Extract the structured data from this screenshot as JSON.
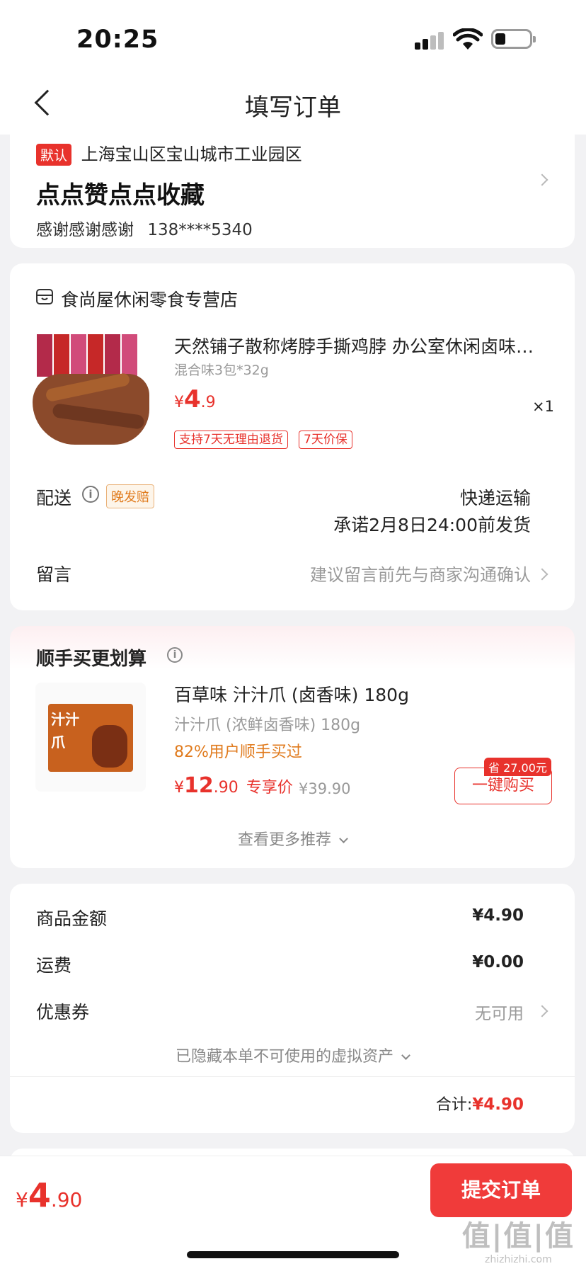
{
  "status_bar": {
    "time": "20:25"
  },
  "nav": {
    "title": "填写订单"
  },
  "address": {
    "default_badge": "默认",
    "region": "上海宝山区宝山城市工业园区",
    "detail": "点点赞点点收藏",
    "name": "感谢感谢感谢",
    "phone": "138****5340"
  },
  "store": {
    "name": "食尚屋休闲零食专营店",
    "product": {
      "title": "天然铺子散称烤脖手撕鸡脖 办公室休闲卤味…",
      "spec": "混合味3包*32g",
      "price_symbol": "¥",
      "price_int": "4",
      "price_dec": ".9",
      "qty": "×1",
      "tags": [
        "支持7天无理由退货",
        "7天价保"
      ]
    },
    "delivery": {
      "label": "配送",
      "badge": "晚发赔",
      "method": "快递运输",
      "promise": "承诺2月8日24:00前发货"
    },
    "remark": {
      "label": "留言",
      "placeholder": "建议留言前先与商家沟通确认"
    }
  },
  "upsell": {
    "title": "顺手买更划算",
    "product": {
      "title": "百草味 汁汁爪 (卤香味) 180g",
      "spec": "汁汁爪 (浓鲜卤香味) 180g",
      "social": "82%用户顺手买过",
      "price_symbol": "¥",
      "price_int": "12",
      "price_dec": ".90",
      "price_label": "专享价",
      "orig_price": "¥39.90",
      "save_badge": "省 27.00元",
      "buy_button": "一键购买"
    },
    "more": "查看更多推荐"
  },
  "summary": {
    "rows": [
      {
        "label": "商品金额",
        "value": "¥4.90"
      },
      {
        "label": "运费",
        "value": "¥0.00"
      },
      {
        "label": "优惠券",
        "value": "无可用"
      }
    ],
    "hidden_assets": "已隐藏本单不可使用的虚拟资产",
    "total_label": "合计:",
    "total_value": "¥4.90"
  },
  "bottom": {
    "price_symbol": "¥",
    "price_int": "4",
    "price_dec": ".90",
    "submit": "提交订单"
  },
  "watermark": {
    "logo": "值|值|值",
    "site": "zhizhizhi.com"
  },
  "colors": {
    "accent": "#e8322c",
    "orange": "#e07a1c"
  }
}
